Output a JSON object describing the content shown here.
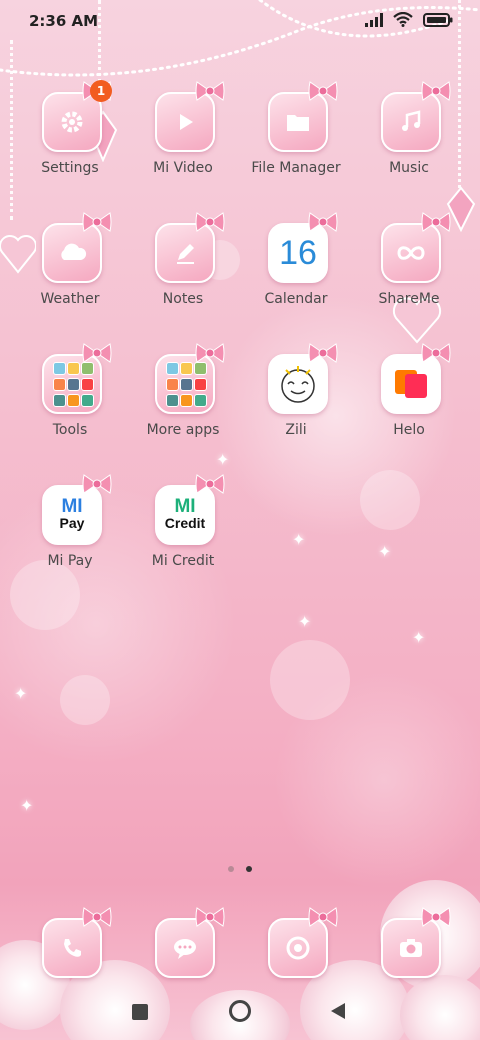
{
  "status_bar": {
    "time": "2:36 AM",
    "icons": [
      "signal-icon",
      "wifi-icon",
      "battery-icon"
    ]
  },
  "apps": [
    {
      "label": "Settings",
      "icon": "gear-icon",
      "badge": "1"
    },
    {
      "label": "Mi Video",
      "icon": "play-icon"
    },
    {
      "label": "File Manager",
      "icon": "folder-icon"
    },
    {
      "label": "Music",
      "icon": "music-note-icon"
    },
    {
      "label": "Weather",
      "icon": "cloud-icon"
    },
    {
      "label": "Notes",
      "icon": "pencil-icon"
    },
    {
      "label": "Calendar",
      "icon": "calendar-icon",
      "date": "16"
    },
    {
      "label": "ShareMe",
      "icon": "infinity-icon"
    },
    {
      "label": "Tools",
      "icon": "folder-grid-icon"
    },
    {
      "label": "More apps",
      "icon": "folder-grid-icon"
    },
    {
      "label": "Zili",
      "icon": "smiley-icon"
    },
    {
      "label": "Helo",
      "icon": "chat-square-icon"
    },
    {
      "label": "Mi Pay",
      "icon": "mi-pay-icon",
      "logo_text": "MI Pay"
    },
    {
      "label": "Mi Credit",
      "icon": "mi-credit-icon",
      "logo_text": "MI Credit"
    }
  ],
  "page_indicator": {
    "pages": 2,
    "active": 2
  },
  "dock": [
    {
      "name": "phone",
      "icon": "phone-icon"
    },
    {
      "name": "messages",
      "icon": "message-icon"
    },
    {
      "name": "browser",
      "icon": "browser-icon"
    },
    {
      "name": "camera",
      "icon": "camera-icon"
    }
  ],
  "navigation": [
    "recents-button",
    "home-button",
    "back-button"
  ],
  "colors": {
    "background": "#f5c1d1",
    "tile": "#f5a8c0",
    "bow": "#f48fb1",
    "badge": "#f25c1f",
    "label": "#4a4a4a"
  }
}
